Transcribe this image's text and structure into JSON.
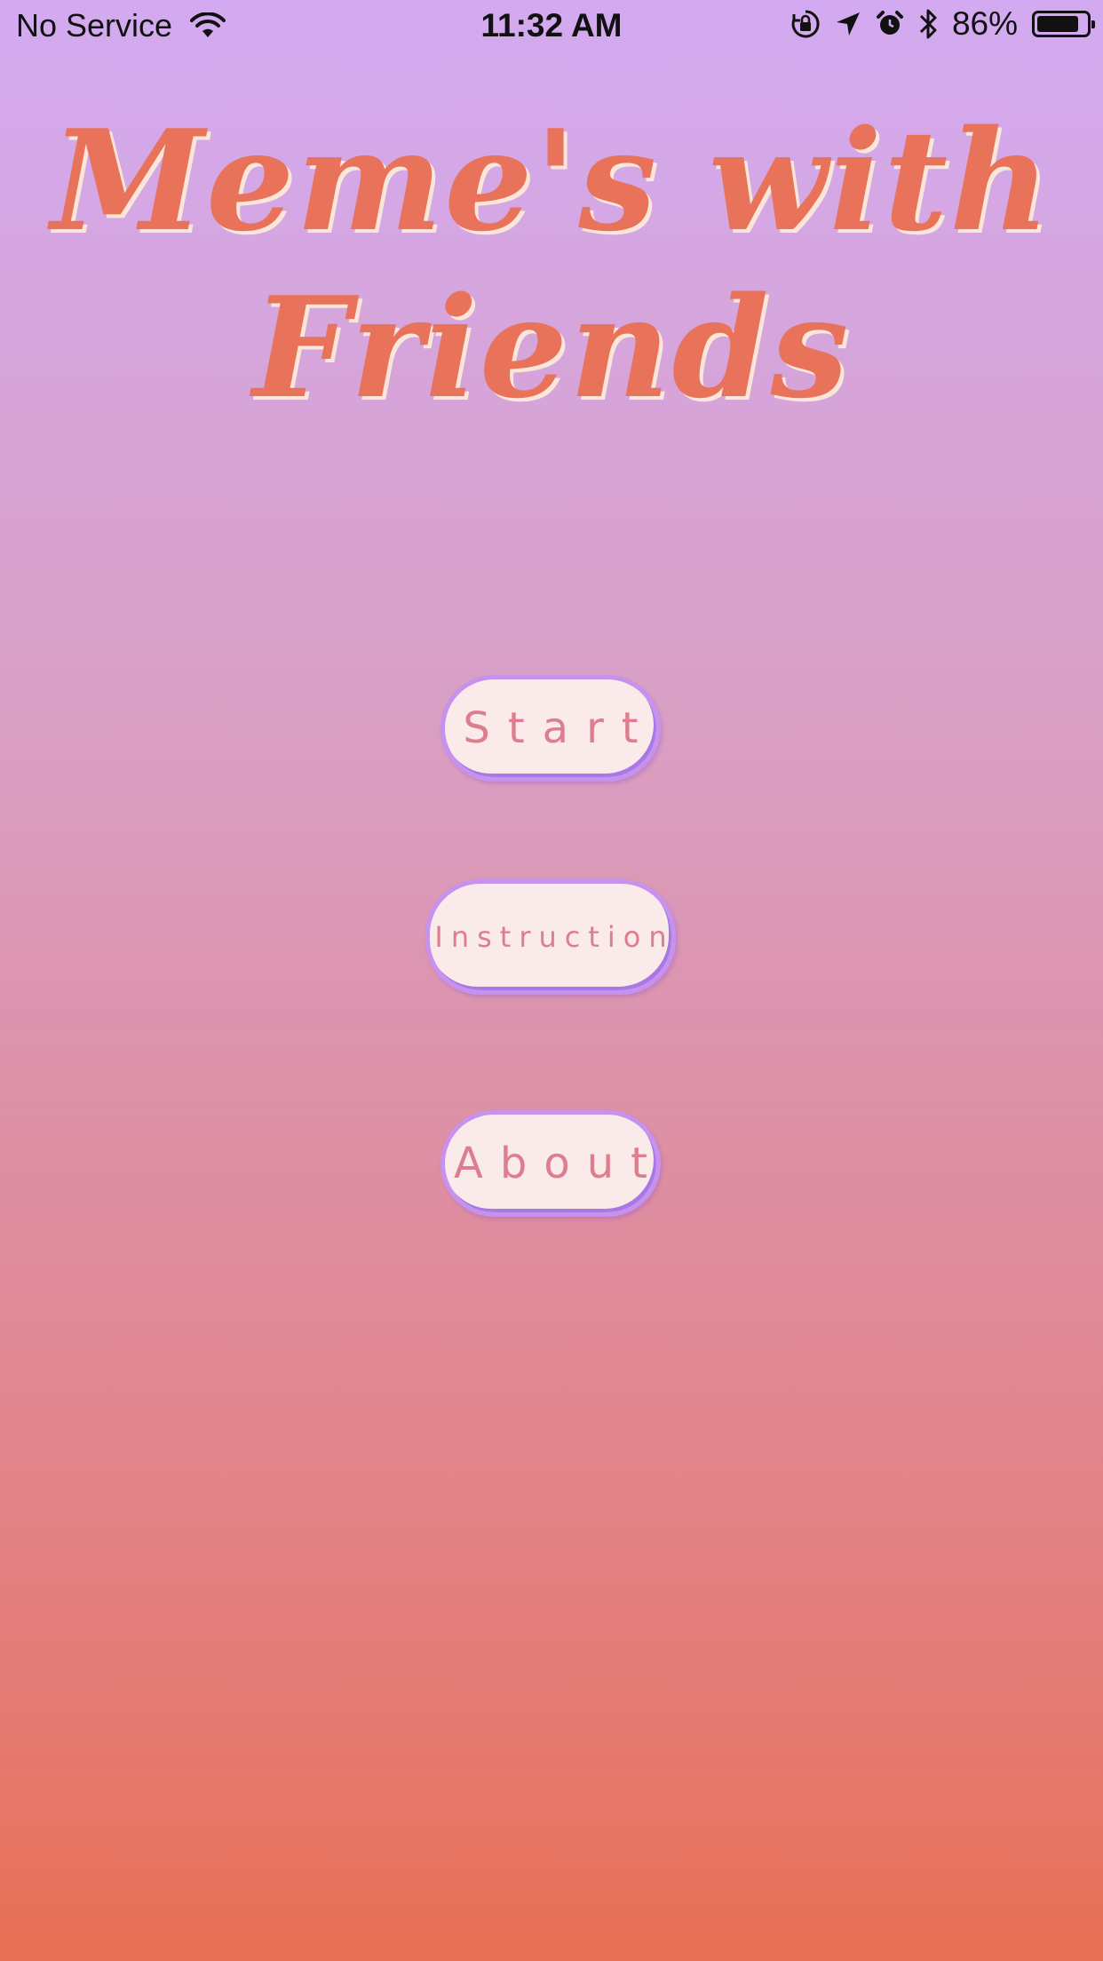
{
  "status_bar": {
    "carrier": "No Service",
    "time": "11:32 AM",
    "battery_percent_text": "86%",
    "battery_level": 0.86,
    "icons": [
      "wifi-icon",
      "orientation-lock-icon",
      "location-arrow-icon",
      "alarm-icon",
      "bluetooth-icon",
      "battery-icon"
    ]
  },
  "title": {
    "line1": "Meme's with",
    "line2": "Friends"
  },
  "menu": {
    "start_label": "Start",
    "instruction_label": "Instruction",
    "about_label": "About"
  },
  "colors": {
    "title": "#e8735a",
    "title_shadow": "#fbe6da",
    "button_fill": "#faeaea",
    "button_border": "#c792ee",
    "button_text": "#dd7e8e",
    "gradient_top": "#d3aaf1",
    "gradient_bottom": "#e76f52"
  }
}
